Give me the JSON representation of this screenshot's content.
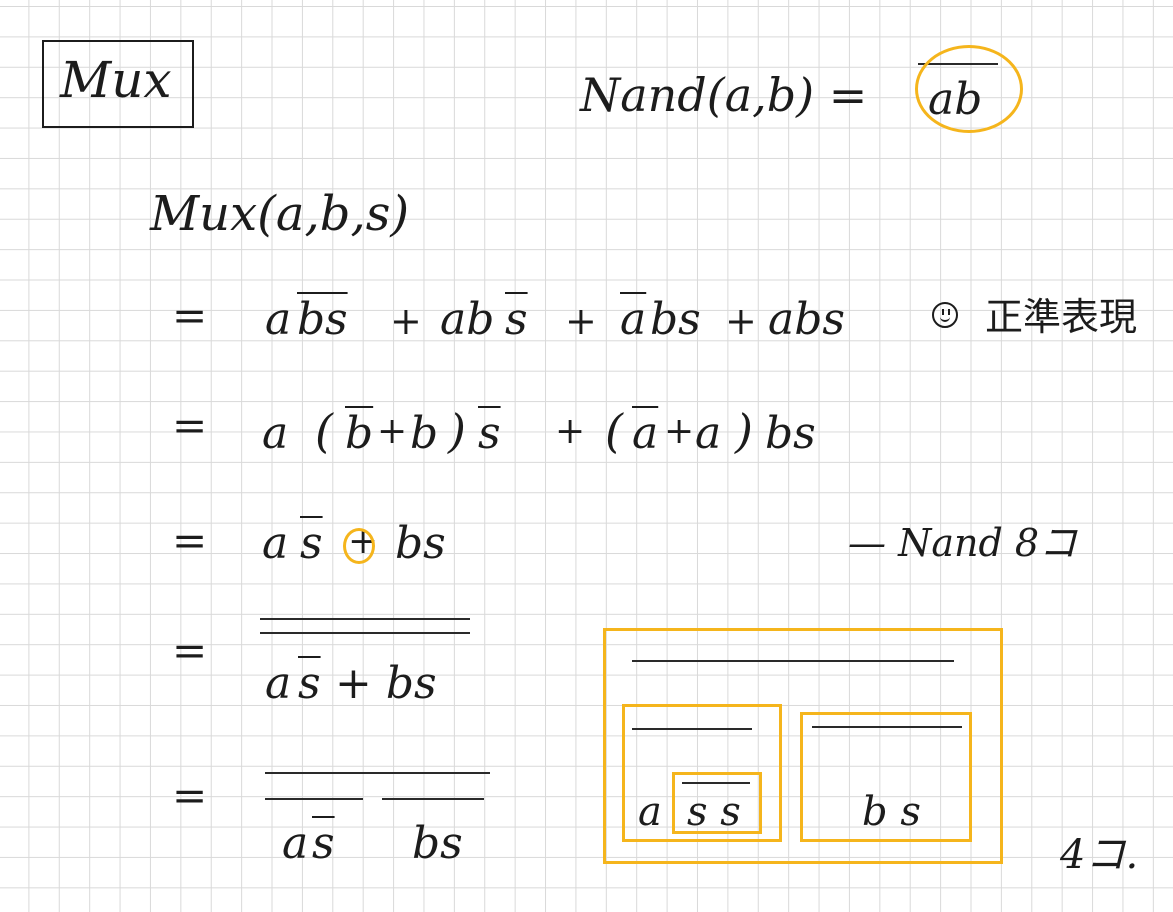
{
  "title": "Mux",
  "nand_def": {
    "lhs": "Nand(a,b) =",
    "rhs": "ab"
  },
  "mux_call": "Mux(a,b,s)",
  "eq": "=",
  "line1": {
    "t1_a": "a",
    "t1_b": "b",
    "t1_s": "s",
    "p1": "+",
    "t2_ab": "ab",
    "t2_s": "s",
    "p2": "+",
    "t3_a": "a",
    "t3_bs": "bs",
    "p3": "+",
    "t4": "abs"
  },
  "annotation": "正準表現",
  "line2": {
    "a": "a",
    "lp": "(",
    "nb": "b",
    "plus": "+",
    "b": "b",
    "rp": ")",
    "ns": "s",
    "p": "+",
    "lp2": "(",
    "na": "a",
    "plus2": "+",
    "a2": "a",
    "rp2": ")",
    "bs": "bs"
  },
  "line3": {
    "a": "a",
    "ns": "s",
    "plus": "+",
    "bs": "bs"
  },
  "nand_count_1": "— Nand 8コ",
  "line4": {
    "expr_a": "a",
    "expr_s": "s",
    "expr_rest": "+ bs"
  },
  "line5": {
    "t1_a": "a",
    "t1_s": "s",
    "t2": "bs"
  },
  "diagram": {
    "left_a": "a",
    "left_ss": "s s",
    "right_bs": "b s"
  },
  "nand_count_2": "4コ.",
  "colors": {
    "ink": "#1c1c1c",
    "highlight": "#f5b51c",
    "grid": "#d9d9d9"
  }
}
